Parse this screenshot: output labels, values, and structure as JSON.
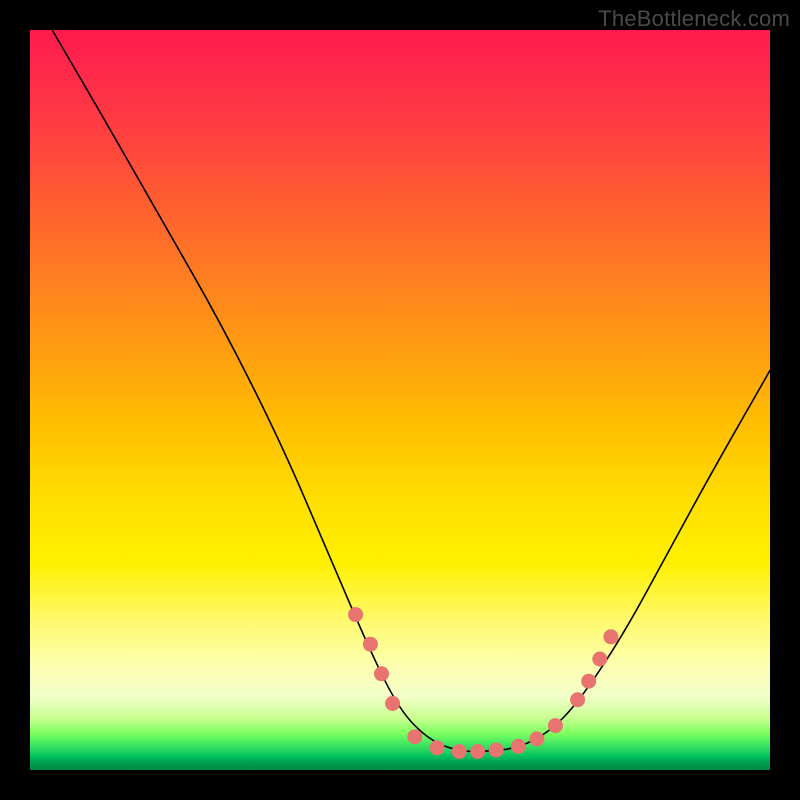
{
  "watermark": "TheBottleneck.com",
  "colors": {
    "dot": "#e9746f",
    "curve": "#000000",
    "frame_bg": "#000000"
  },
  "chart_data": {
    "type": "line",
    "title": "",
    "xlabel": "",
    "ylabel": "",
    "xlim": [
      0,
      100
    ],
    "ylim": [
      0,
      100
    ],
    "grid": false,
    "legend": false,
    "curve": {
      "name": "bottleneck-curve",
      "points": [
        {
          "x": 3,
          "y": 100
        },
        {
          "x": 10,
          "y": 88
        },
        {
          "x": 18,
          "y": 74
        },
        {
          "x": 26,
          "y": 60
        },
        {
          "x": 34,
          "y": 44
        },
        {
          "x": 40,
          "y": 30
        },
        {
          "x": 46,
          "y": 16
        },
        {
          "x": 50,
          "y": 8
        },
        {
          "x": 54,
          "y": 4
        },
        {
          "x": 58,
          "y": 2.5
        },
        {
          "x": 62,
          "y": 2.5
        },
        {
          "x": 66,
          "y": 3
        },
        {
          "x": 70,
          "y": 5
        },
        {
          "x": 74,
          "y": 9
        },
        {
          "x": 80,
          "y": 18
        },
        {
          "x": 86,
          "y": 29
        },
        {
          "x": 92,
          "y": 40
        },
        {
          "x": 100,
          "y": 54
        }
      ]
    },
    "markers": {
      "name": "highlight-dots",
      "points": [
        {
          "x": 44,
          "y": 21
        },
        {
          "x": 46,
          "y": 17
        },
        {
          "x": 47.5,
          "y": 13
        },
        {
          "x": 49,
          "y": 9
        },
        {
          "x": 52,
          "y": 4.5
        },
        {
          "x": 55,
          "y": 3
        },
        {
          "x": 58,
          "y": 2.5
        },
        {
          "x": 60.5,
          "y": 2.5
        },
        {
          "x": 63,
          "y": 2.7
        },
        {
          "x": 66,
          "y": 3.2
        },
        {
          "x": 68.5,
          "y": 4.2
        },
        {
          "x": 71,
          "y": 6
        },
        {
          "x": 74,
          "y": 9.5
        },
        {
          "x": 75.5,
          "y": 12
        },
        {
          "x": 77,
          "y": 15
        },
        {
          "x": 78.5,
          "y": 18
        }
      ]
    }
  }
}
